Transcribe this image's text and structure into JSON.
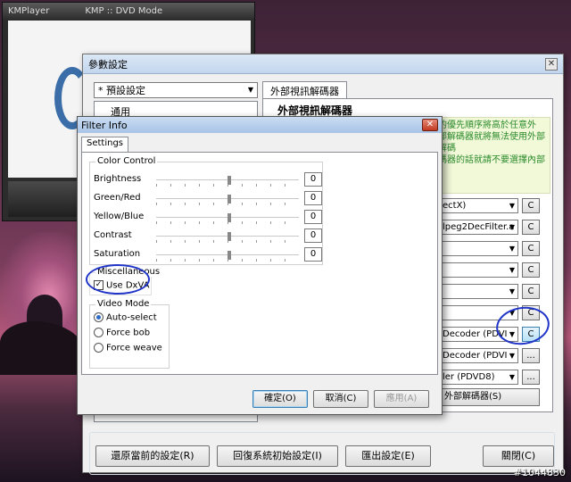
{
  "kmplayer": {
    "app_name": "KMPlayer",
    "title": "KMP :: DVD Mode"
  },
  "preferences": {
    "title": "參數設定",
    "close_glyph": "✕",
    "preset": "* 預設設定",
    "tree": [
      "通用"
    ],
    "tab": "外部視訊解碼器",
    "heading": "外部視訊解碼器",
    "description": "的優先順序將高於任意外\n部解碼器就將無法使用外部解碼\n碼器的話就請不要選擇內部",
    "decoders": [
      {
        "label": "ectX)",
        "button": "C",
        "highlight": false
      },
      {
        "label": "lpeg2DecFilter.a",
        "button": "C",
        "highlight": false
      },
      {
        "label": "",
        "button": "C",
        "highlight": false
      },
      {
        "label": "",
        "button": "C",
        "highlight": false
      },
      {
        "label": "",
        "button": "C",
        "highlight": false
      },
      {
        "label": "",
        "button": "C",
        "highlight": false
      },
      {
        "label": "Decoder (PDVI",
        "button": "C",
        "highlight": true
      },
      {
        "label": "Decoder (PDVI",
        "button": "...",
        "highlight": false
      },
      {
        "label": "ler (PDVD8)",
        "button": "...",
        "highlight": false
      }
    ],
    "ext_button": "外部解碼器(S)",
    "footer": {
      "restore": "還原當前的設定(R)",
      "reset": "回復系統初始設定(I)",
      "export": "匯出設定(E)",
      "close": "關閉(C)"
    }
  },
  "filter_info": {
    "title": "Filter Info",
    "close_glyph": "✕",
    "tab": "Settings",
    "color_control": {
      "label": "Color Control",
      "sliders": [
        {
          "name": "Brightness",
          "value": "0",
          "position": 0.5
        },
        {
          "name": "Green/Red",
          "value": "0",
          "position": 0.5
        },
        {
          "name": "Yellow/Blue",
          "value": "0",
          "position": 0.5
        },
        {
          "name": "Contrast",
          "value": "0",
          "position": 0.5
        },
        {
          "name": "Saturation",
          "value": "0",
          "position": 0.5
        }
      ]
    },
    "misc": {
      "label": "Miscellaneous",
      "use_dxva": "Use DxVA",
      "checked": true,
      "check_glyph": "✓"
    },
    "video_mode": {
      "label": "Video Mode",
      "options": [
        {
          "label": "Auto-select",
          "selected": true
        },
        {
          "label": "Force bob",
          "selected": false
        },
        {
          "label": "Force weave",
          "selected": false
        }
      ]
    },
    "buttons": {
      "ok": "確定(O)",
      "cancel": "取消(C)",
      "apply": "應用(A)"
    }
  },
  "watermark": "#1044830",
  "colors": {
    "annotation": "#2034c8",
    "desc_text": "#2a8a2a"
  },
  "icons": {
    "dropdown": "▼"
  }
}
